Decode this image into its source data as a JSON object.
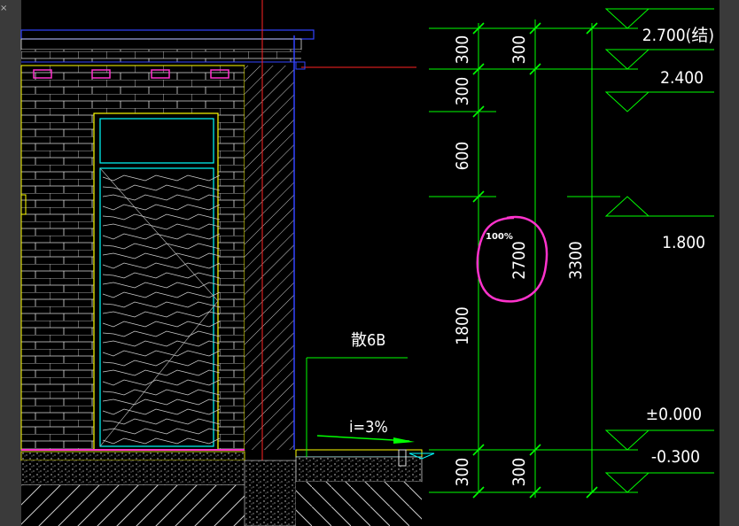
{
  "window": {
    "close_glyph": "×",
    "zoom_label": "100%"
  },
  "drawing": {
    "dims_column1": [
      "300",
      "300",
      "600",
      "1800",
      "300"
    ],
    "dims_column2": [
      "300",
      "2700",
      "300"
    ],
    "dims_column3": [
      "3300"
    ],
    "elevations": [
      "2.700(结)",
      "2.400",
      "1.800",
      "±0.000",
      "-0.300"
    ],
    "annotation_label": "散6B",
    "slope_label": "i=3%"
  },
  "colors": {
    "background": "#000000",
    "dimension": "#00ff00",
    "text": "#ffffff",
    "brick": "#ffffff",
    "outline": "#ffff00",
    "window_frame": "#00ffff",
    "highlight": "#ff33cc",
    "axis": "#ff0000",
    "wall_edge": "#3344ff"
  }
}
